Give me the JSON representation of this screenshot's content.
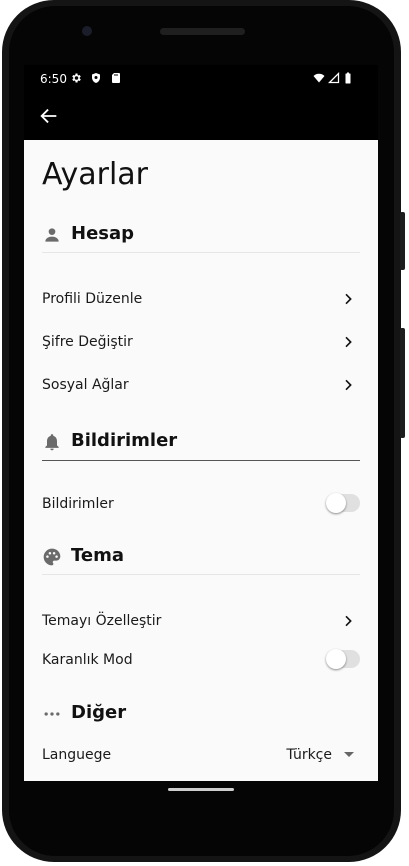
{
  "status_bar": {
    "time": "6:50",
    "left_icons": [
      "settings-gear-icon",
      "shield-icon",
      "sd-card-icon"
    ],
    "right_icons": [
      "wifi-icon",
      "signal-icon",
      "battery-icon"
    ]
  },
  "app_bar": {
    "back_icon": "arrow-left-icon"
  },
  "page": {
    "title": "Ayarlar"
  },
  "sections": {
    "account": {
      "icon": "person-icon",
      "label": "Hesap",
      "items": [
        {
          "label": "Profili Düzenle"
        },
        {
          "label": "Şifre Değiştir"
        },
        {
          "label": "Sosyal Ağlar"
        }
      ]
    },
    "notifications": {
      "icon": "bell-icon",
      "label": "Bildirimler",
      "items": [
        {
          "label": "Bildirimler",
          "enabled": false
        }
      ]
    },
    "theme": {
      "icon": "palette-icon",
      "label": "Tema",
      "items": [
        {
          "label": "Temayı Özelleştir"
        },
        {
          "label": "Karanlık Mod",
          "enabled": false
        }
      ]
    },
    "other": {
      "icon": "more-horizontal-icon",
      "label": "Diğer",
      "items": [
        {
          "label": "Languege",
          "value": "Türkçe"
        }
      ]
    }
  },
  "colors": {
    "background": "#fafafa",
    "app_bar": "#000000",
    "text": "#111111",
    "icon": "#6b6b6b",
    "toggle_track_off": "#e0e0e0"
  }
}
